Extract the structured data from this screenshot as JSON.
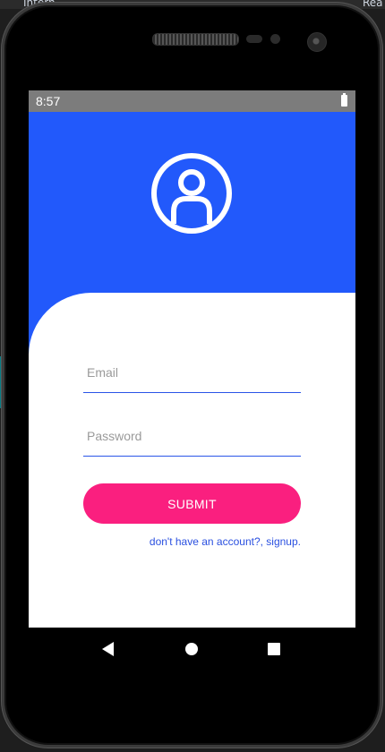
{
  "host": {
    "left_fragment": "Intern",
    "right_fragment": "Rea"
  },
  "status_bar": {
    "time": "8:57",
    "battery": "battery-icon"
  },
  "header": {
    "color": "#2259fb",
    "avatar_icon": "account-circle-icon"
  },
  "form": {
    "email": {
      "placeholder": "Email",
      "value": ""
    },
    "password": {
      "placeholder": "Password",
      "value": ""
    },
    "submit_label": "SUBMIT",
    "signup_link": "don't have an account?, signup.",
    "accent_color": "#2a55e8",
    "button_color": "#fa1f7f"
  },
  "nav_bar": {
    "back": "back-icon",
    "home": "home-icon",
    "recents": "recents-icon"
  }
}
